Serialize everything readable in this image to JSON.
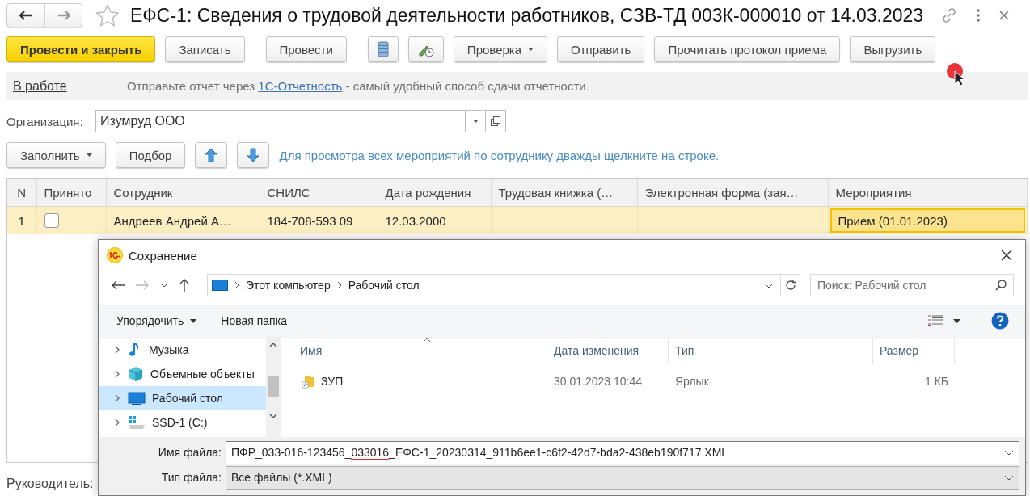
{
  "window": {
    "title": "ЕФС-1: Сведения о трудовой деятельности работников, СЗВ-ТД 003К-000010 от 14.03.2023",
    "favorite": false
  },
  "toolbar": [
    {
      "label": "Провести и закрыть",
      "kind": "primary"
    },
    {
      "label": "Записать",
      "kind": "plain"
    },
    {
      "label": "Провести",
      "kind": "plain"
    },
    {
      "kind": "icon"
    },
    {
      "kind": "icon"
    },
    {
      "label": "Проверка",
      "kind": "dropdown"
    },
    {
      "label": "Отправить",
      "kind": "plain"
    },
    {
      "label": "Прочитать протокол приема",
      "kind": "plain"
    },
    {
      "label": "Выгрузить",
      "kind": "plain"
    }
  ],
  "info_bar": {
    "status": "В работе",
    "message_before": "Отправьте отчет через ",
    "message_link": "1С-Отчетность",
    "message_after": " - самый удобный способ сдачи отчетности."
  },
  "organization": {
    "label": "Организация:",
    "value": "Изумруд ООО"
  },
  "table_toolbar": {
    "buttons": [
      {
        "label": "Заполнить",
        "kind": "dropdown"
      },
      {
        "label": "Подбор",
        "kind": "plain"
      },
      {
        "kind": "up"
      },
      {
        "kind": "down"
      }
    ],
    "hint": "Для просмотра всех мероприятий по сотруднику дважды щелкните на строке."
  },
  "table": {
    "columns": [
      "N",
      "Принято",
      "Сотрудник",
      "СНИЛС",
      "Дата рождения",
      "Трудовая книжка (…",
      "Электронная форма (зая…",
      "Мероприятия"
    ],
    "rows": [
      {
        "selected": true,
        "cells": [
          {
            "kind": "number",
            "text": "1",
            "focused": false
          },
          {
            "kind": "checkbox",
            "checked": false,
            "focused": false
          },
          {
            "kind": "text",
            "text": "Андреев Андрей А…",
            "focused": false
          },
          {
            "kind": "text",
            "text": "184-708-593 09",
            "focused": false
          },
          {
            "kind": "text",
            "text": "12.03.2000",
            "focused": false
          },
          {
            "kind": "text",
            "text": "",
            "focused": false
          },
          {
            "kind": "text",
            "text": "",
            "focused": false
          },
          {
            "kind": "text",
            "text": "Прием (01.01.2023)",
            "focused": true
          }
        ]
      }
    ]
  },
  "footer": {
    "label": "Руководитель:"
  },
  "save_dialog": {
    "title": "Сохранение",
    "address": [
      "Этот компьютер",
      "Рабочий стол"
    ],
    "search": {
      "placeholder": "Поиск: Рабочий стол"
    },
    "commands": [
      {
        "label": "Упорядочить",
        "kind": "dropdown"
      },
      {
        "label": "Новая папка",
        "kind": "plain"
      }
    ],
    "tree": [
      {
        "label": "Музыка",
        "kind": "music",
        "selected": false,
        "expanded": false
      },
      {
        "label": "Объемные объекты",
        "kind": "objects",
        "selected": false,
        "expanded": false
      },
      {
        "label": "Рабочий стол",
        "kind": "desktop",
        "selected": true,
        "expanded": false
      },
      {
        "label": "SSD-1 (C:)",
        "kind": "drive",
        "selected": false,
        "expanded": false
      }
    ],
    "columns": [
      "Имя",
      "Дата изменения",
      "Тип",
      "Размер"
    ],
    "files": [
      {
        "name": "ЗУП",
        "modified": "30.01.2023 10:44",
        "type": "Ярлык",
        "size": "1 КБ"
      }
    ],
    "filename": {
      "label": "Имя файла:",
      "before": "ПФР_033-016-123456_",
      "marked": "033016",
      "after": "_ЕФС-1_20230314_911b6ee1-c6f2-42d7-bda2-438eb190f717.XML"
    },
    "filetype": {
      "label": "Тип файла:",
      "value": "Все файлы (*.XML)"
    }
  }
}
